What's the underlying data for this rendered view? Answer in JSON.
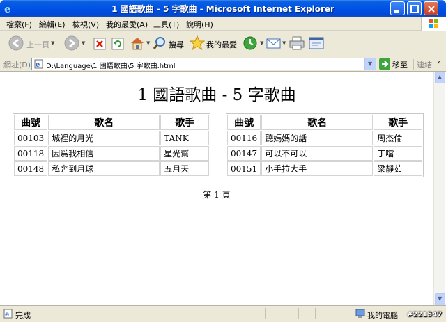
{
  "window": {
    "title": "1 國語歌曲 - 5 字歌曲 - Microsoft Internet Explorer"
  },
  "menu": {
    "file": "檔案(F)",
    "edit": "編輯(E)",
    "view": "檢視(V)",
    "favorites": "我的最愛(A)",
    "tools": "工具(T)",
    "help": "說明(H)"
  },
  "toolbar": {
    "back": "上一頁",
    "search": "搜尋",
    "favorites": "我的最愛"
  },
  "address": {
    "label": "網址(D)",
    "url": "D:\\Language\\1 國語歌曲\\5 字歌曲.html",
    "go": "移至",
    "links": "連結"
  },
  "page": {
    "title": "1 國語歌曲 - 5 字歌曲",
    "headers": [
      "曲號",
      "歌名",
      "歌手"
    ],
    "left_rows": [
      {
        "id": "00103",
        "name": "城裡的月光",
        "singer": "TANK"
      },
      {
        "id": "00118",
        "name": "因爲我相信",
        "singer": "星光幫"
      },
      {
        "id": "00148",
        "name": "私奔到月球",
        "singer": "五月天"
      }
    ],
    "right_rows": [
      {
        "id": "00116",
        "name": "聽媽媽的話",
        "singer": "周杰倫"
      },
      {
        "id": "00147",
        "name": "可以不可以",
        "singer": "丁噹"
      },
      {
        "id": "00151",
        "name": "小手拉大手",
        "singer": "梁靜茹"
      }
    ],
    "page_number": "第 1 頁"
  },
  "status": {
    "text": "完成",
    "zone": "我的電腦"
  },
  "watermark": "#221547"
}
